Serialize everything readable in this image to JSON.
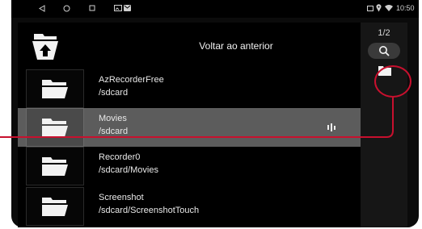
{
  "status_bar": {
    "time": "10:50",
    "left_icons": [
      "back-triangle-icon",
      "home-circle-icon",
      "recents-square-icon",
      "gallery-icon",
      "message-icon"
    ],
    "right_icons": [
      "sim-icon",
      "location-icon",
      "wifi-icon"
    ]
  },
  "file_browser": {
    "header": {
      "label": "Voltar ao anterior",
      "icon": "folder-up-arrow-icon"
    },
    "items": [
      {
        "name": "AzRecorderFree",
        "path": "/sdcard",
        "selected": false
      },
      {
        "name": "Movies",
        "path": "/sdcard",
        "selected": true,
        "playing": true
      },
      {
        "name": "Recorder0",
        "path": "/sdcard/Movies",
        "selected": false
      },
      {
        "name": "Screenshot",
        "path": "/sdcard/ScreenshotTouch",
        "selected": false
      }
    ]
  },
  "side_panel": {
    "page_indicator": "1/2",
    "buttons": [
      {
        "icon": "search-icon"
      },
      {
        "icon": "folder-icon"
      }
    ]
  },
  "annotation": {
    "color": "#c8102e"
  },
  "colors": {
    "background": "#000000",
    "selected_row": "#5c5c5c",
    "side_panel": "#161616",
    "accent_red": "#c8102e"
  }
}
